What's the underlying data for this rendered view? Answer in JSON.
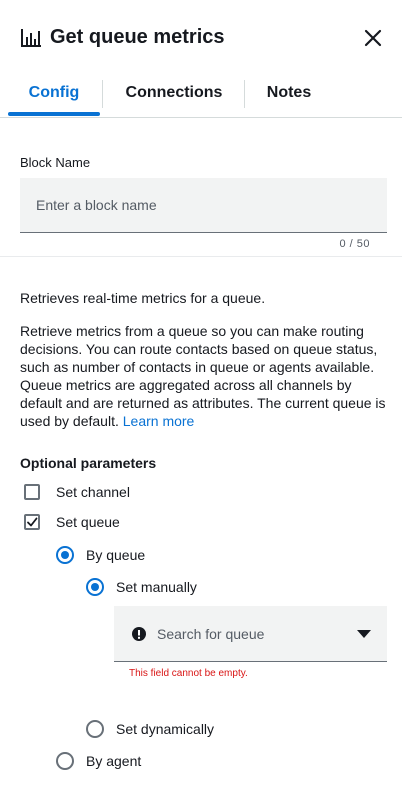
{
  "header": {
    "title": "Get queue metrics",
    "title_icon": "bar-chart-icon",
    "close_icon": "close-icon"
  },
  "tabs": [
    {
      "label": "Config",
      "active": true
    },
    {
      "label": "Connections",
      "active": false
    },
    {
      "label": "Notes",
      "active": false
    }
  ],
  "block_name": {
    "label": "Block Name",
    "placeholder": "Enter a block name",
    "value": "",
    "counter": "0 / 50"
  },
  "description": {
    "summary": "Retrieves real-time metrics for a queue.",
    "body": "Retrieve metrics from a queue so you can make routing decisions. You can route contacts based on queue status, such as number of contacts in queue or agents available. Queue metrics are aggregated across all channels by default and are returned as attributes. The current queue is used by default.",
    "link": "Learn more"
  },
  "optional_parameters": {
    "heading": "Optional parameters",
    "set_channel": {
      "label": "Set channel",
      "checked": false
    },
    "set_queue": {
      "label": "Set queue",
      "checked": true
    },
    "by_queue": {
      "label": "By queue",
      "selected": true
    },
    "set_manually": {
      "label": "Set manually",
      "selected": true
    },
    "queue_search": {
      "placeholder": "Search for queue",
      "error": "This field cannot be empty."
    },
    "set_dynamically": {
      "label": "Set dynamically",
      "selected": false
    },
    "by_agent": {
      "label": "By agent",
      "selected": false
    }
  },
  "colors": {
    "accent": "#0972d3",
    "error": "#d91515",
    "text": "#16191f",
    "input_bg": "#f2f3f3"
  }
}
